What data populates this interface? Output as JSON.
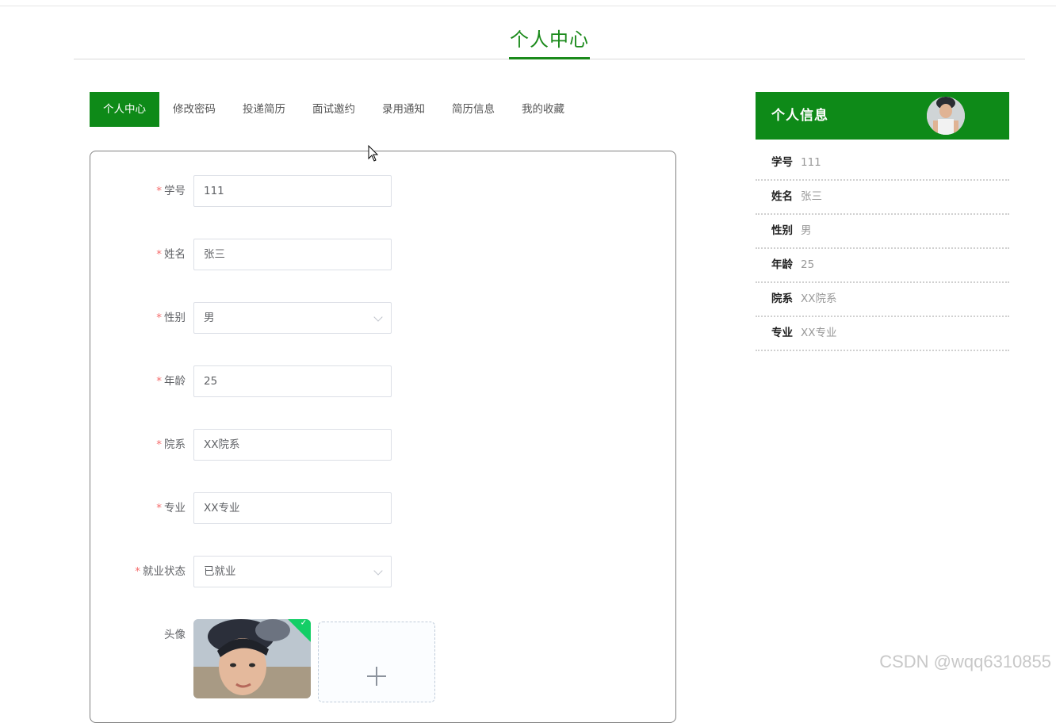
{
  "page": {
    "title": "个人中心"
  },
  "tabs": [
    {
      "label": "个人中心",
      "active": true
    },
    {
      "label": "修改密码",
      "active": false
    },
    {
      "label": "投递简历",
      "active": false
    },
    {
      "label": "面试邀约",
      "active": false
    },
    {
      "label": "录用通知",
      "active": false
    },
    {
      "label": "简历信息",
      "active": false
    },
    {
      "label": "我的收藏",
      "active": false
    }
  ],
  "form": {
    "student_id": {
      "label": "学号",
      "required_mark": "*",
      "value": "111"
    },
    "name": {
      "label": "姓名",
      "required_mark": "*",
      "value": "张三"
    },
    "gender": {
      "label": "性别",
      "required_mark": "*",
      "value": "男"
    },
    "age": {
      "label": "年龄",
      "required_mark": "*",
      "value": "25"
    },
    "department": {
      "label": "院系",
      "required_mark": "*",
      "value": "XX院系"
    },
    "major": {
      "label": "专业",
      "required_mark": "*",
      "value": "XX专业"
    },
    "employment_status": {
      "label": "就业状态",
      "required_mark": "*",
      "value": "已就业"
    },
    "avatar": {
      "label": "头像"
    }
  },
  "info_card": {
    "title": "个人信息",
    "rows": [
      {
        "key": "学号",
        "value": "111"
      },
      {
        "key": "姓名",
        "value": "张三"
      },
      {
        "key": "性别",
        "value": "男"
      },
      {
        "key": "年龄",
        "value": "25"
      },
      {
        "key": "院系",
        "value": "XX院系"
      },
      {
        "key": "专业",
        "value": "XX专业"
      }
    ]
  },
  "watermark": "CSDN @wqq6310855",
  "colors": {
    "brand_green": "#0e8a18",
    "title_green": "#1b8a1b",
    "required_red": "#f56c6c",
    "upload_success": "#13ce66"
  },
  "icons": {
    "select_arrow": "chevron-down-icon",
    "upload": "plus-icon",
    "upload_done": "check-icon"
  }
}
